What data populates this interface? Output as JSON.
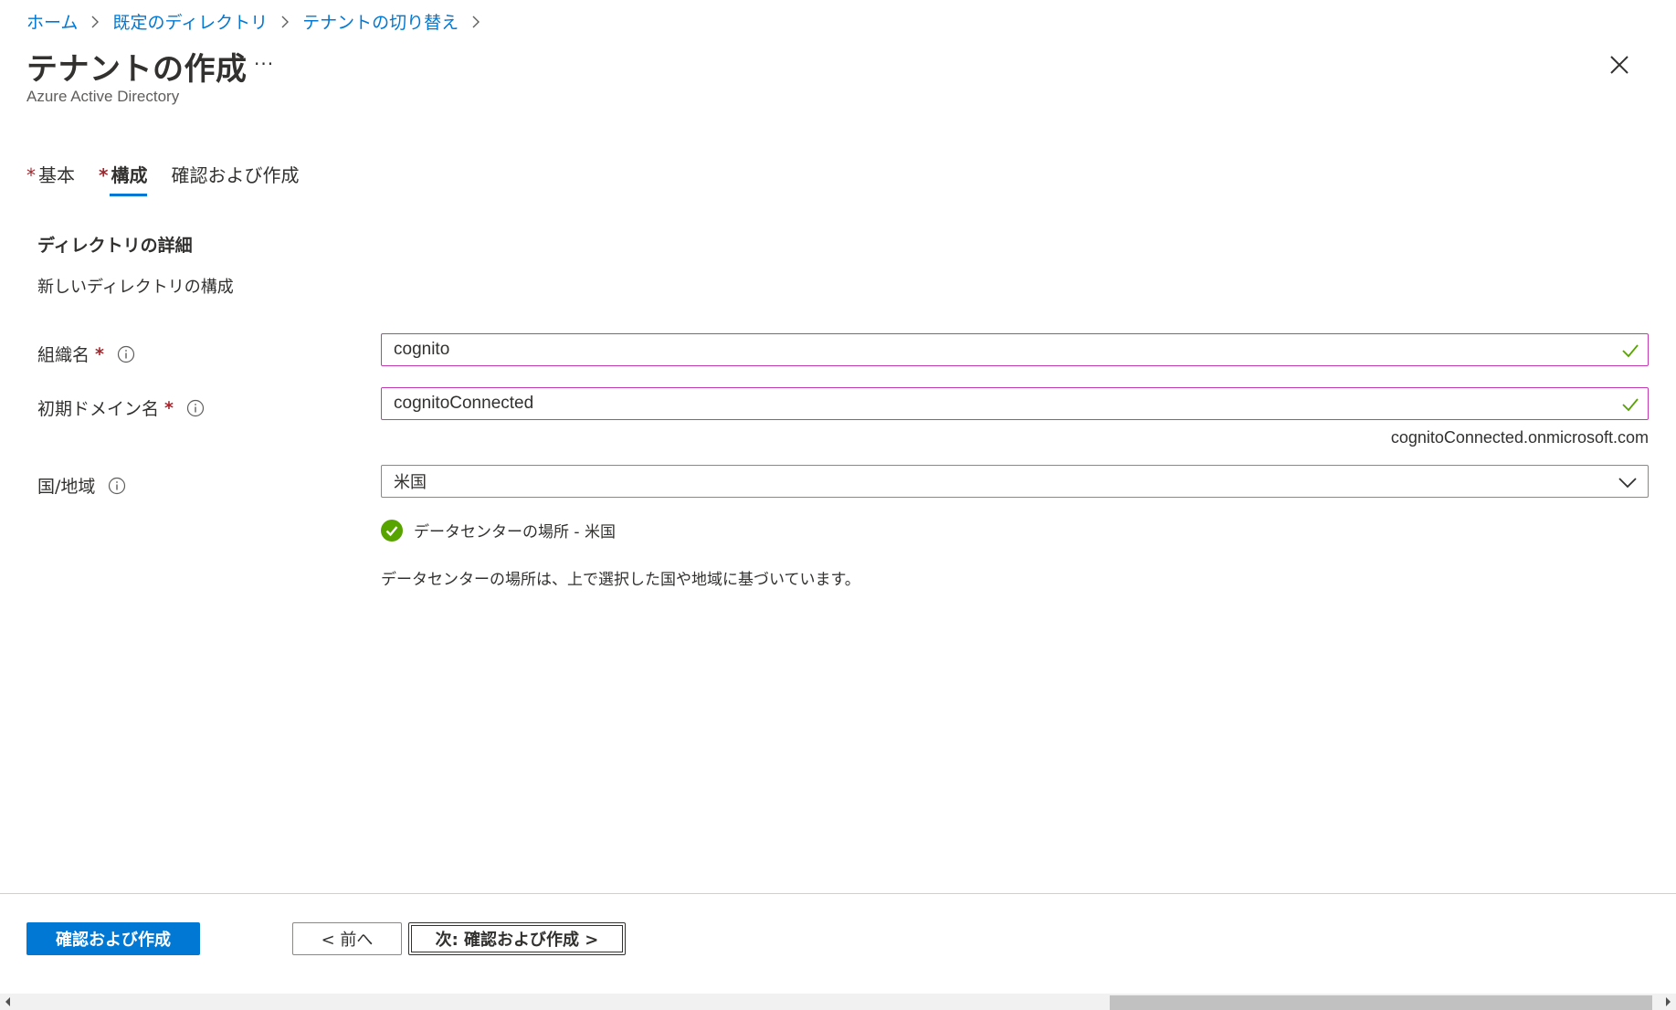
{
  "breadcrumb": {
    "items": [
      "ホーム",
      "既定のディレクトリ",
      "テナントの切り替え"
    ]
  },
  "header": {
    "title": "テナントの作成",
    "more": "···",
    "subtitle": "Azure Active Directory"
  },
  "tabs": [
    {
      "label": "基本",
      "required": "*",
      "active": false
    },
    {
      "label": "構成",
      "required": "*",
      "active": true
    },
    {
      "label": "確認および作成",
      "required": "",
      "active": false
    }
  ],
  "section": {
    "title": "ディレクトリの詳細",
    "description": "新しいディレクトリの構成"
  },
  "form": {
    "org_name": {
      "label": "組織名",
      "required": "*",
      "value": "cognito"
    },
    "initial_domain": {
      "label": "初期ドメイン名",
      "required": "*",
      "value": "cognitoConnected",
      "suffix": "cognitoConnected.onmicrosoft.com"
    },
    "country": {
      "label": "国/地域",
      "value": "米国"
    }
  },
  "datacenter": {
    "status": "データセンターの場所 - 米国",
    "note": "データセンターの場所は、上で選択した国や地域に基づいています。"
  },
  "footer": {
    "review_create": "確認および作成",
    "previous": "< 前へ",
    "next": "次: 確認および作成 >"
  },
  "colors": {
    "accent": "#0078d4",
    "valid": "#57a300",
    "required": "#a4262c",
    "field_border": "#c239b3"
  }
}
